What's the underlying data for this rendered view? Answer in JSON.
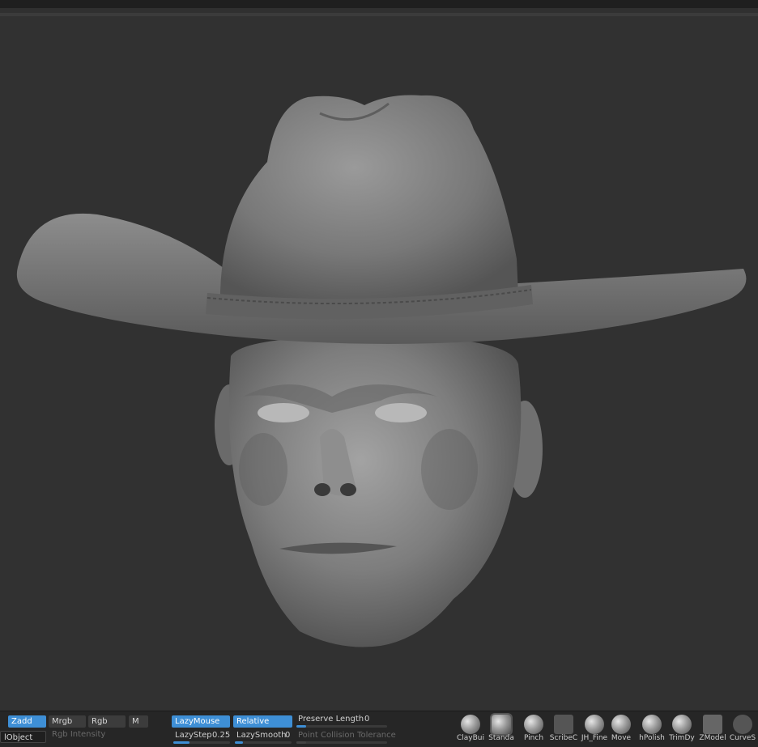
{
  "viewport": {
    "subject": ""
  },
  "toolbar": {
    "zadd": "Zadd",
    "mrgb": "Mrgb",
    "rgb": "Rgb",
    "m": "M",
    "rgb_intensity": "Rgb Intensity",
    "subtool_label": "lObject",
    "lazymouse": "LazyMouse",
    "relative": "Relative",
    "preserve_length_label": "Preserve Length",
    "preserve_length_value": "0",
    "lazystep_label": "LazyStep",
    "lazystep_value": "0.25",
    "lazysmooth_label": "LazySmooth",
    "lazysmooth_value": "0",
    "point_collision_label": "Point Collision Tolerance"
  },
  "brushes": [
    {
      "name": "ClayBui",
      "icon": "clay-brush-icon"
    },
    {
      "name": "Standa",
      "icon": "standard-brush-icon"
    },
    {
      "name": "Pinch",
      "icon": "pinch-brush-icon"
    },
    {
      "name": "ScribeC",
      "icon": "scribe-brush-icon"
    },
    {
      "name": "JH_Fine",
      "icon": "sphere-brush-icon"
    },
    {
      "name": "Move",
      "icon": "move-brush-icon"
    },
    {
      "name": "hPolish",
      "icon": "polish-brush-icon"
    },
    {
      "name": "TrimDy",
      "icon": "trim-brush-icon"
    },
    {
      "name": "ZModel",
      "icon": "zmodel-brush-icon"
    },
    {
      "name": "CurveS",
      "icon": "curve-brush-icon"
    }
  ],
  "colors": {
    "accent": "#3e8fd6",
    "canvas": "#313131"
  }
}
